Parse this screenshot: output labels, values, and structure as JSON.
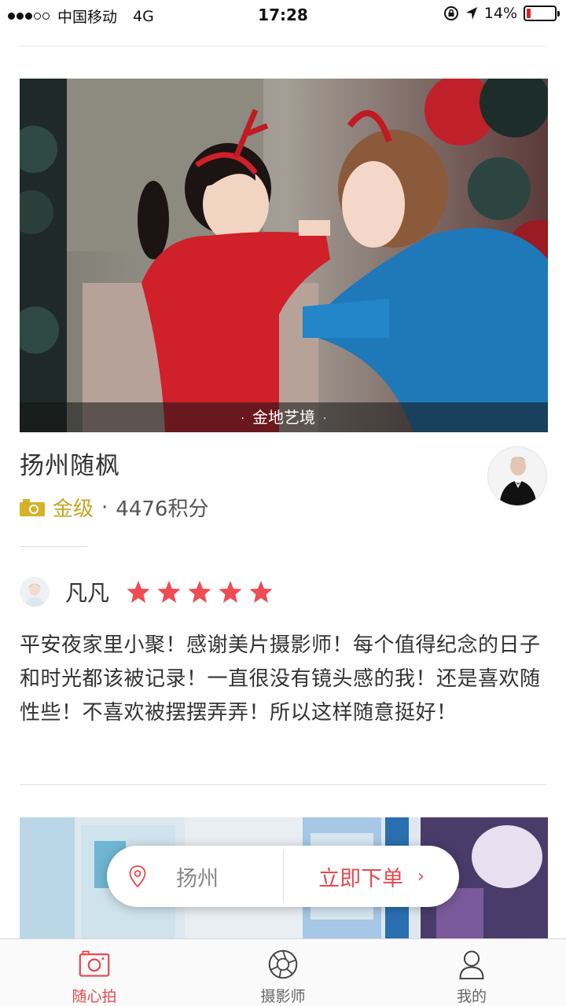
{
  "status_bar": {
    "carrier": "中国移动",
    "network": "4G",
    "time": "17:28",
    "battery": "14%",
    "battery_level": 0.14
  },
  "card1": {
    "photo_caption": "金地艺境",
    "studio_name": "扬州随枫",
    "level_label": "金级",
    "separator": "·",
    "points": "4476积分",
    "camera_icon_color": "#d6b22a"
  },
  "review": {
    "reviewer_name": "凡凡",
    "rating": 5,
    "star_color": "#ee4b52",
    "text": "平安夜家里小聚！感谢美片摄影师！每个值得纪念的日子和时光都该被记录！一直很没有镜头感的我！还是喜欢随性些！不喜欢被摆摆弄弄！所以这样随意挺好！"
  },
  "order_bar": {
    "city": "扬州",
    "order_label": "立即下单",
    "chevron": "›",
    "accent": "#e8484f"
  },
  "tabs": [
    {
      "label": "随心拍",
      "icon": "camera-icon",
      "active": true
    },
    {
      "label": "摄影师",
      "icon": "aperture-icon",
      "active": false
    },
    {
      "label": "我的",
      "icon": "person-icon",
      "active": false
    }
  ]
}
